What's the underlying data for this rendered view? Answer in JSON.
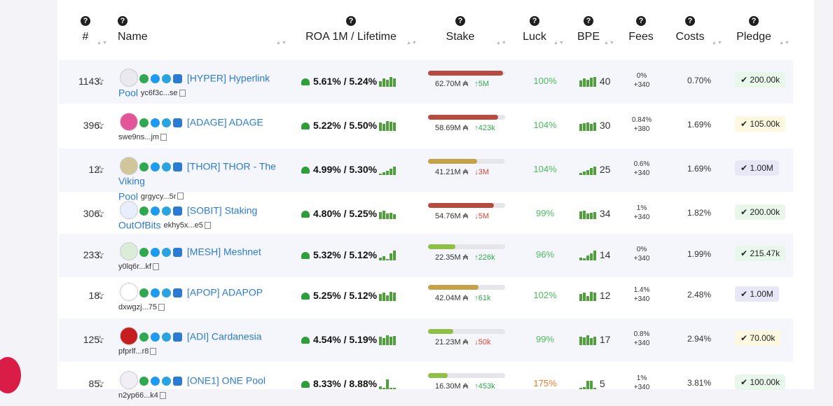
{
  "header": {
    "help_glyph": "?",
    "columns": {
      "rank": "#",
      "name": "Name",
      "roa": "ROA 1M / Lifetime",
      "stake": "Stake",
      "luck": "Luck",
      "bpe": "BPE",
      "fees": "Fees",
      "costs": "Costs",
      "pledge": "Pledge"
    },
    "sort_glyph": "▲▼"
  },
  "glyphs": {
    "star": "☆",
    "check": "✔",
    "ada": "₳",
    "up": "↑",
    "down": "↓"
  },
  "rows": [
    {
      "rank": "1143.",
      "name_line1": "[HYPER] Hyperlink",
      "name_line2": "Pool",
      "id": "yc6f3c...se",
      "roa": "5.61% / 5.24%",
      "stake": "62.70M",
      "delta": "5M",
      "delta_dir": "up",
      "stake_fill_pct": 97,
      "stake_color": "#b84a3f",
      "luck": "100%",
      "bpe": "40",
      "fee_pct": "0%",
      "fee_fixed": "+340",
      "costs": "0.70%",
      "pledge": "200.00k",
      "pledge_style": "green"
    },
    {
      "rank": "396.",
      "name_line1": "[ADAGE] ADAGE",
      "name_line2": "",
      "id": "swe9ns...jm",
      "roa": "5.22% / 5.50%",
      "stake": "58.69M",
      "delta": "423k",
      "delta_dir": "up",
      "stake_fill_pct": 91,
      "stake_color": "#b84a3f",
      "luck": "104%",
      "bpe": "30",
      "fee_pct": "0.84%",
      "fee_fixed": "+380",
      "costs": "1.69%",
      "pledge": "105.00k",
      "pledge_style": "yellow"
    },
    {
      "rank": "12.",
      "name_line1": "[THOR] THOR - The Viking",
      "name_line2": "Pool",
      "id": "grgycy...5r",
      "roa": "4.99% / 5.30%",
      "stake": "41.21M",
      "delta": "3M",
      "delta_dir": "down",
      "stake_fill_pct": 64,
      "stake_color": "#c3a248",
      "luck": "104%",
      "bpe": "25",
      "fee_pct": "0.6%",
      "fee_fixed": "+340",
      "costs": "1.69%",
      "pledge": "1.00M",
      "pledge_style": "purple"
    },
    {
      "rank": "306.",
      "name_line1": "[SOBIT] Staking",
      "name_line2": "OutOfBits",
      "id": "ekhy5x...e5",
      "roa": "4.80% / 5.25%",
      "stake": "54.76M",
      "delta": "5M",
      "delta_dir": "down",
      "stake_fill_pct": 85,
      "stake_color": "#b84a3f",
      "luck": "99%",
      "bpe": "34",
      "fee_pct": "1%",
      "fee_fixed": "+340",
      "costs": "1.82%",
      "pledge": "200.00k",
      "pledge_style": "green"
    },
    {
      "rank": "233.",
      "name_line1": "[MESH] Meshnet",
      "name_line2": "",
      "id": "y0lq6r...kf",
      "roa": "5.32% / 5.12%",
      "stake": "22.35M",
      "delta": "226k",
      "delta_dir": "up",
      "stake_fill_pct": 35,
      "stake_color": "#8dc043",
      "luck": "96%",
      "bpe": "14",
      "fee_pct": "0%",
      "fee_fixed": "+340",
      "costs": "1.99%",
      "pledge": "215.47k",
      "pledge_style": "green"
    },
    {
      "rank": "18.",
      "name_line1": "[APOP] ADAPOP",
      "name_line2": "",
      "id": "dxwgzj...75",
      "roa": "5.25% / 5.12%",
      "stake": "42.04M",
      "delta": "61k",
      "delta_dir": "up",
      "stake_fill_pct": 65,
      "stake_color": "#c3a248",
      "luck": "102%",
      "bpe": "12",
      "fee_pct": "1.4%",
      "fee_fixed": "+340",
      "costs": "2.48%",
      "pledge": "1.00M",
      "pledge_style": "purple"
    },
    {
      "rank": "125.",
      "name_line1": "[ADI] Cardanesia",
      "name_line2": "",
      "id": "pfprlf...r8",
      "roa": "4.54% / 5.19%",
      "stake": "21.23M",
      "delta": "50k",
      "delta_dir": "down",
      "stake_fill_pct": 33,
      "stake_color": "#8dc043",
      "luck": "99%",
      "bpe": "17",
      "fee_pct": "0.8%",
      "fee_fixed": "+340",
      "costs": "2.94%",
      "pledge": "70.00k",
      "pledge_style": "yellow"
    },
    {
      "rank": "85.",
      "name_line1": "[ONE1] ONE Pool",
      "name_line2": "",
      "id": "n2yp66...k4",
      "roa": "8.33% / 8.88%",
      "stake": "16.30M",
      "delta": "453k",
      "delta_dir": "up",
      "stake_fill_pct": 25,
      "stake_color": "#8dc043",
      "luck": "175%",
      "luck_color": "orange",
      "bpe": "5",
      "fee_pct": "1%",
      "fee_fixed": "+340",
      "costs": "3.81%",
      "pledge": "100.00k",
      "pledge_style": "green"
    }
  ],
  "colors": {
    "link": "#2b7bd2",
    "luck_good": "#4cbc5c",
    "luck_high": "#f07c28",
    "up": "#2fa84f",
    "down": "#d84535"
  }
}
